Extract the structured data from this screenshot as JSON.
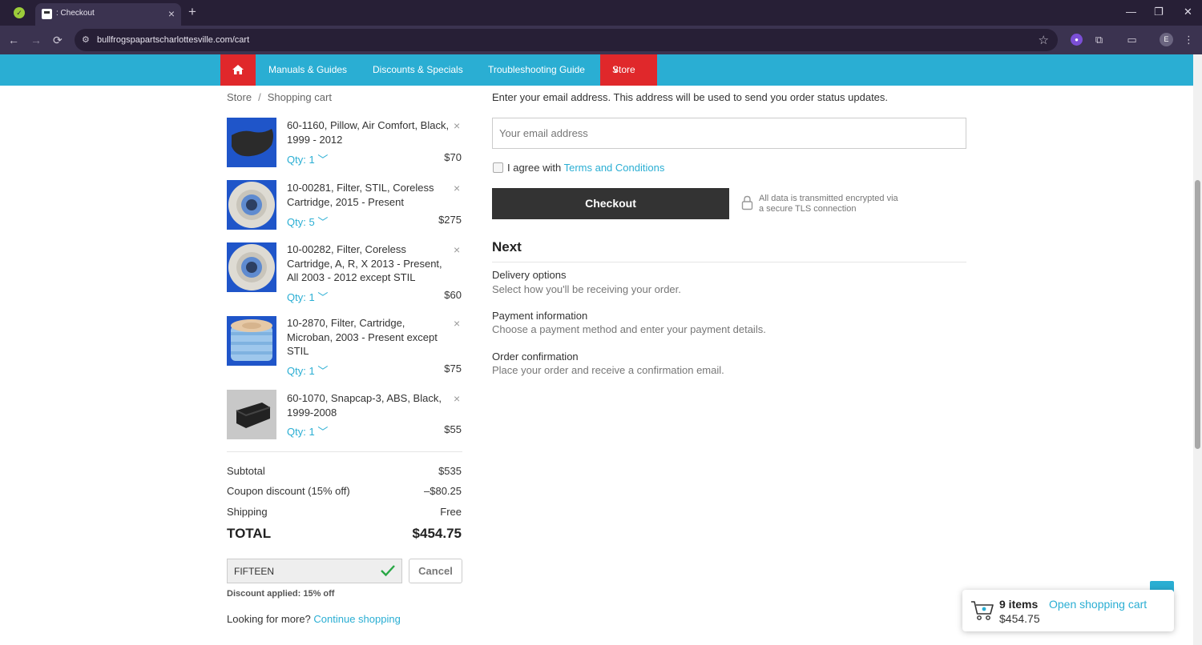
{
  "browser": {
    "tab_title": ": Checkout",
    "tab_close": "×",
    "new_tab": "+",
    "url": "bullfrogspapartscharlottesville.com/cart",
    "back": "←",
    "forward": "→",
    "reload": "⟳",
    "minimize": "—",
    "restore": "❐",
    "close": "✕",
    "profile_initial": "E"
  },
  "nav": {
    "links": [
      "Manuals & Guides",
      "Discounts & Specials",
      "Troubleshooting Guide"
    ],
    "store_label": "Store",
    "colors": {
      "bar": "#2aaed3",
      "accent": "#e0282b"
    }
  },
  "breadcrumb": {
    "store": "Store",
    "separator": "/",
    "current": "Shopping cart"
  },
  "cart": {
    "items": [
      {
        "title": "60-1160, Pillow, Air Comfort, Black, 1999 - 2012",
        "qty": "Qty: 1",
        "price": "$70"
      },
      {
        "title": "10-00281, Filter, STIL, Coreless Cartridge, 2015 - Present",
        "qty": "Qty: 5",
        "price": "$275"
      },
      {
        "title": "10-00282, Filter, Coreless Cartridge, A, R, X 2013 - Present, All 2003 - 2012 except STIL",
        "qty": "Qty: 1",
        "price": "$60"
      },
      {
        "title": "10-2870, Filter, Cartridge, Microban, 2003 - Present except STIL",
        "qty": "Qty: 1",
        "price": "$75"
      },
      {
        "title": "60-1070, Snapcap-3, ABS, Black, 1999-2008",
        "qty": "Qty: 1",
        "price": "$55"
      }
    ],
    "remove_icon": "×",
    "qty_chevron": "﹀",
    "subtotal_label": "Subtotal",
    "subtotal": "$535",
    "discount_label": "Coupon discount (15% off)",
    "discount": "–$80.25",
    "shipping_label": "Shipping",
    "shipping": "Free",
    "total_label": "TOTAL",
    "total": "$454.75"
  },
  "coupon": {
    "code": "FIFTEEN",
    "cancel_label": "Cancel",
    "note": "Discount applied: 15% off"
  },
  "more": {
    "text": "Looking for more?",
    "link": "Continue shopping"
  },
  "checkout": {
    "email_intro": "Enter your email address. This address will be used to send you order status updates.",
    "email_placeholder": "Your email address",
    "agree_text": "I agree with",
    "agree_link": "Terms and Conditions",
    "button": "Checkout",
    "secure_line1": "All data is transmitted encrypted via",
    "secure_line2": "a secure TLS connection"
  },
  "next": {
    "heading": "Next",
    "steps": [
      {
        "title": "Delivery options",
        "desc": "Select how you'll be receiving your order."
      },
      {
        "title": "Payment information",
        "desc": "Choose a payment method and enter your payment details."
      },
      {
        "title": "Order confirmation",
        "desc": "Place your order and receive a confirmation email."
      }
    ]
  },
  "float_cart": {
    "count": "9 items",
    "open_label": "Open shopping cart",
    "total": "$454.75"
  }
}
